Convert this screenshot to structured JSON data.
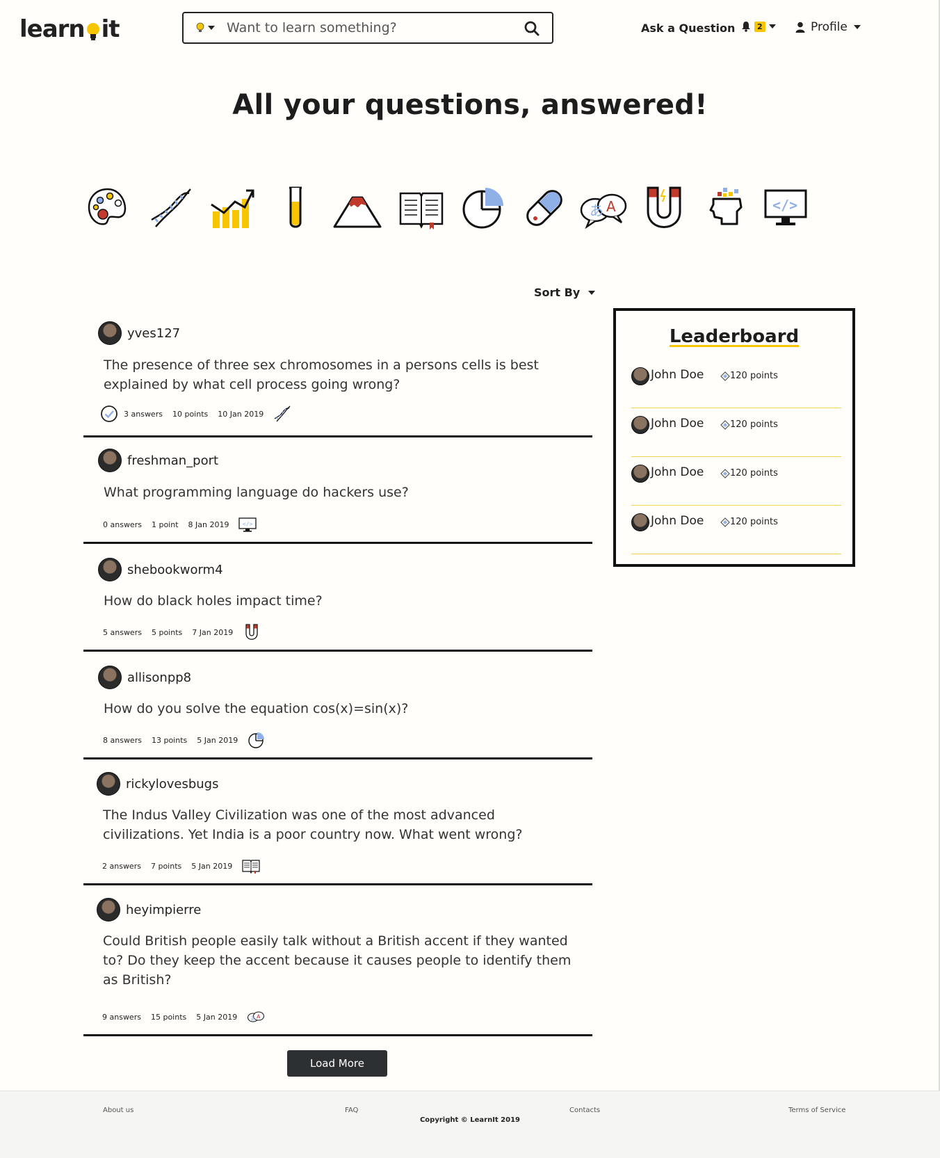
{
  "header": {
    "logo_text_1": "learn",
    "logo_text_2": "it",
    "search_placeholder": "Want to learn something?",
    "ask_label": "Ask a Question",
    "notification_count": "2",
    "profile_label": "Profile"
  },
  "hero": {
    "title": "All your questions, answered!"
  },
  "categories": [
    {
      "icon": "palette-icon"
    },
    {
      "icon": "dna-icon"
    },
    {
      "icon": "chart-growth-icon"
    },
    {
      "icon": "test-tube-icon"
    },
    {
      "icon": "mountain-icon"
    },
    {
      "icon": "book-icon"
    },
    {
      "icon": "pie-chart-icon"
    },
    {
      "icon": "pill-icon"
    },
    {
      "icon": "language-icon"
    },
    {
      "icon": "magnet-icon"
    },
    {
      "icon": "brain-icon"
    },
    {
      "icon": "code-monitor-icon"
    }
  ],
  "sort": {
    "label": "Sort By"
  },
  "questions": [
    {
      "user": "yves127",
      "text": "The presence of three sex chromosomes in a persons cells is best explained by what cell process going wrong?",
      "answers": "3 answers",
      "points": "10 points",
      "date": "10 Jan 2019",
      "category_icon": "dna-icon",
      "answered": true
    },
    {
      "user": "freshman_port",
      "text": "What programming language do hackers use?",
      "answers": "0 answers",
      "points": "1 point",
      "date": "8 Jan 2019",
      "category_icon": "code-monitor-icon",
      "answered": false
    },
    {
      "user": "shebookworm4",
      "text": "How do black holes impact time?",
      "answers": "5 answers",
      "points": "5 points",
      "date": "7 Jan 2019",
      "category_icon": "magnet-icon",
      "answered": false
    },
    {
      "user": "allisonpp8",
      "text": "How do you solve the equation cos(x)=sin(x)?",
      "answers": "8 answers",
      "points": "13 points",
      "date": "5 Jan 2019",
      "category_icon": "pie-chart-icon",
      "answered": false
    },
    {
      "user": "rickylovesbugs",
      "text": "The Indus Valley Civilization was one of the most advanced civilizations. Yet India is a poor country now. What went wrong?",
      "answers": "2 answers",
      "points": "7 points",
      "date": "5 Jan 2019",
      "category_icon": "book-icon",
      "answered": false
    },
    {
      "user": "heyimpierre",
      "text": "Could British people easily talk without a British accent if they wanted to? Do they keep the accent because it causes people to identify them as British?",
      "answers": "9 answers",
      "points": "15 points",
      "date": "5 Jan 2019",
      "category_icon": "language-icon",
      "answered": false
    }
  ],
  "load_more": "Load More",
  "leaderboard": {
    "title": "Leaderboard",
    "entries": [
      {
        "name": "John Doe",
        "points": "120 points"
      },
      {
        "name": "John Doe",
        "points": "120 points"
      },
      {
        "name": "John Doe",
        "points": "120 points"
      },
      {
        "name": "John Doe",
        "points": "120 points"
      }
    ]
  },
  "footer": {
    "about": "About us",
    "faq": "FAQ",
    "contacts": "Contacts",
    "terms": "Terms of Service",
    "copyright": "Copyright © LearnIt 2019"
  },
  "colors": {
    "accent": "#f7c600",
    "dark": "#2d3033",
    "blue": "#8fb0e6",
    "red": "#c0392b"
  }
}
